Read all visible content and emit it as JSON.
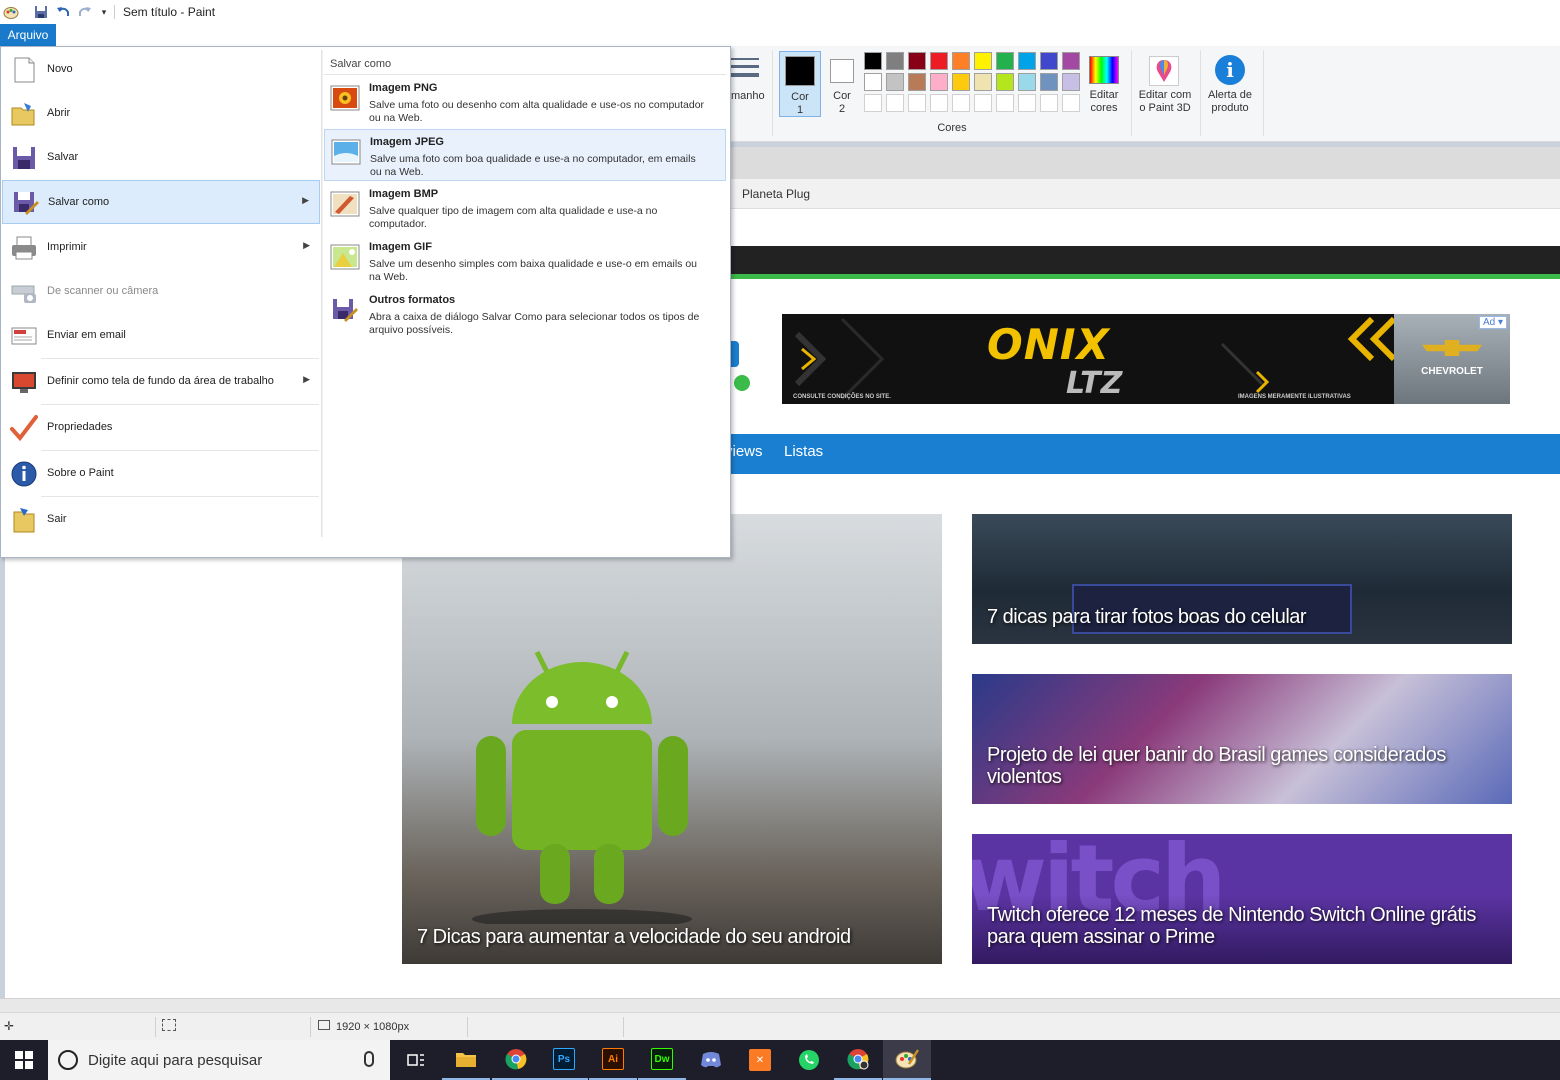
{
  "window": {
    "title": "Sem título - Paint",
    "menu_tab": "Arquivo"
  },
  "ribbon": {
    "size_label": "manho",
    "color1_label": "Cor\n1",
    "color1_line1": "Cor",
    "color1_line2": "1",
    "color2_line1": "Cor",
    "color2_line2": "2",
    "edit_colors_line1": "Editar",
    "edit_colors_line2": "cores",
    "paint3d_line1": "Editar com",
    "paint3d_line2": "o Paint 3D",
    "alert_line1": "Alerta de",
    "alert_line2": "produto",
    "group_colors": "Cores",
    "palette_row1": [
      "#000000",
      "#7f7f7f",
      "#880015",
      "#ed1c24",
      "#ff7f27",
      "#fff200",
      "#22b14c",
      "#00a2e8",
      "#3f48cc",
      "#a349a4"
    ],
    "palette_row2": [
      "#ffffff",
      "#c3c3c3",
      "#b97a57",
      "#ffaec9",
      "#ffc90e",
      "#efe4b0",
      "#b5e61d",
      "#99d9ea",
      "#7092be",
      "#c8bfe7"
    ],
    "color1": "#000000",
    "color2": "#ffffff"
  },
  "file_menu": {
    "items": [
      {
        "label": "Novo",
        "icon": "new-file-icon"
      },
      {
        "label": "Abrir",
        "icon": "open-folder-icon"
      },
      {
        "label": "Salvar",
        "icon": "floppy-disk-icon"
      },
      {
        "label": "Salvar como",
        "icon": "save-as-icon"
      },
      {
        "label": "Imprimir",
        "icon": "printer-icon"
      },
      {
        "label": "De scanner ou câmera",
        "icon": "scanner-icon"
      },
      {
        "label": "Enviar em email",
        "icon": "email-icon"
      },
      {
        "label": "Definir como tela de fundo da área de trabalho",
        "icon": "desktop-background-icon"
      },
      {
        "label": "Propriedades",
        "icon": "checkmark-icon"
      },
      {
        "label": "Sobre o Paint",
        "icon": "info-icon"
      },
      {
        "label": "Sair",
        "icon": "exit-icon"
      }
    ],
    "submenu": {
      "header": "Salvar como",
      "items": [
        {
          "title": "Imagem PNG",
          "desc": "Salve uma foto ou desenho com alta qualidade e use-os no computador ou na Web."
        },
        {
          "title": "Imagem JPEG",
          "desc": "Salve uma foto com boa qualidade e use-a no computador, em emails ou na Web."
        },
        {
          "title": "Imagem BMP",
          "desc": "Salve qualquer tipo de imagem com alta qualidade e use-a no computador."
        },
        {
          "title": "Imagem GIF",
          "desc": "Salve um desenho simples com baixa qualidade e use-o em emails ou na Web."
        },
        {
          "title": "Outros formatos",
          "desc": "Abra a caixa de diálogo Salvar Como para selecionar todos os tipos de arquivo possíveis."
        }
      ]
    }
  },
  "webpage": {
    "bookmark": "Planeta Plug",
    "ad": {
      "badge": "Ad",
      "headline": "ONIX",
      "subheadline": "LTZ",
      "brand": "CHEVROLET",
      "note_left": "CONSULTE CONDIÇÕES NO SITE.",
      "note_right": "IMAGENS MERAMENTE ILUSTRATIVAS"
    },
    "nav": [
      "views",
      "Listas"
    ],
    "articles": [
      {
        "caption": "7 Dicas para aumentar a velocidade do seu android"
      },
      {
        "caption": "7 dicas para tirar fotos boas do celular"
      },
      {
        "caption": "Projeto de lei quer banir do Brasil games considerados violentos"
      },
      {
        "caption": "Twitch oferece 12 meses de Nintendo Switch Online grátis para quem assinar o Prime"
      }
    ]
  },
  "statusbar": {
    "dimensions": "1920 × 1080px"
  },
  "taskbar": {
    "search_placeholder": "Digite aqui para pesquisar",
    "apps": [
      "Ps",
      "Ai",
      "Dw"
    ]
  }
}
